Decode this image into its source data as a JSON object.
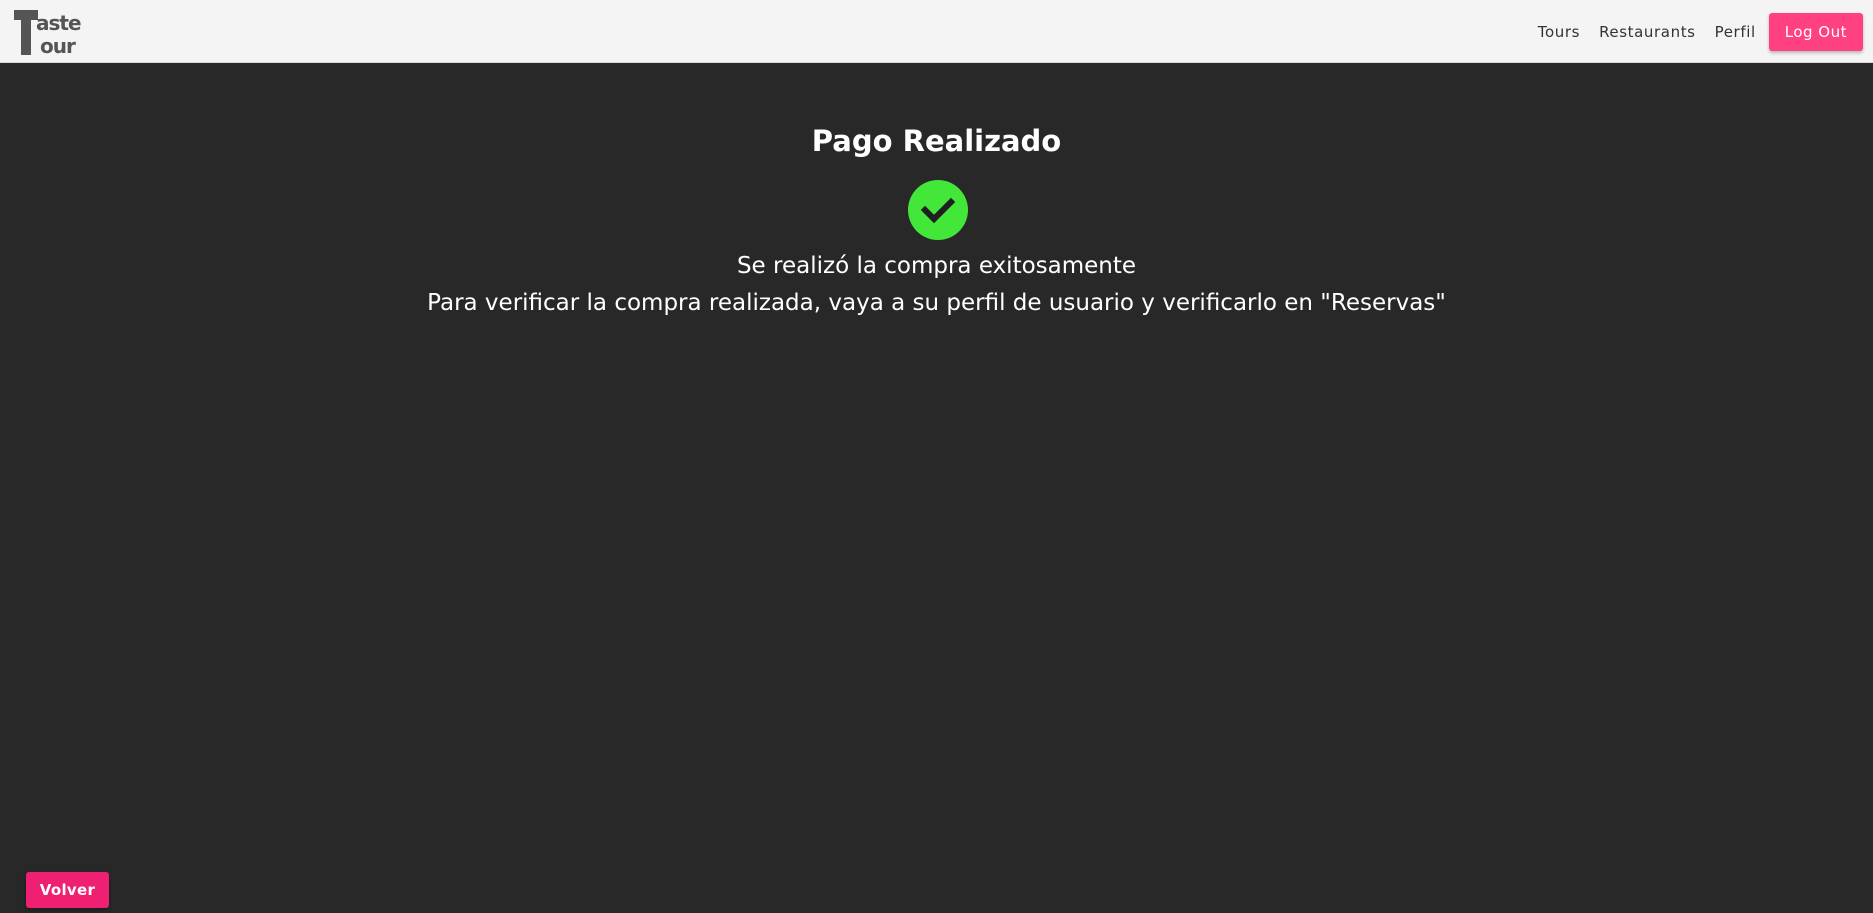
{
  "header": {
    "logo": {
      "line1": "Taste",
      "line2": "Tour",
      "icon": "taste-tour-logo"
    },
    "nav": [
      {
        "label": "Tours"
      },
      {
        "label": "Restaurants"
      },
      {
        "label": "Perfil"
      }
    ],
    "logout_label": "Log Out"
  },
  "main": {
    "title": "Pago Realizado",
    "status_icon": "check-circle-icon",
    "message_line1": "Se realizó la compra exitosamente",
    "message_line2": "Para verificar la compra realizada, vaya a su perfil de usuario y verificarlo en \"Reservas\""
  },
  "footer": {
    "back_label": "Volver"
  },
  "colors": {
    "background": "#282828",
    "navbar": "#f4f4f4",
    "accent": "#ff4081",
    "back_button": "#ef1f72",
    "success": "#43e73a"
  }
}
